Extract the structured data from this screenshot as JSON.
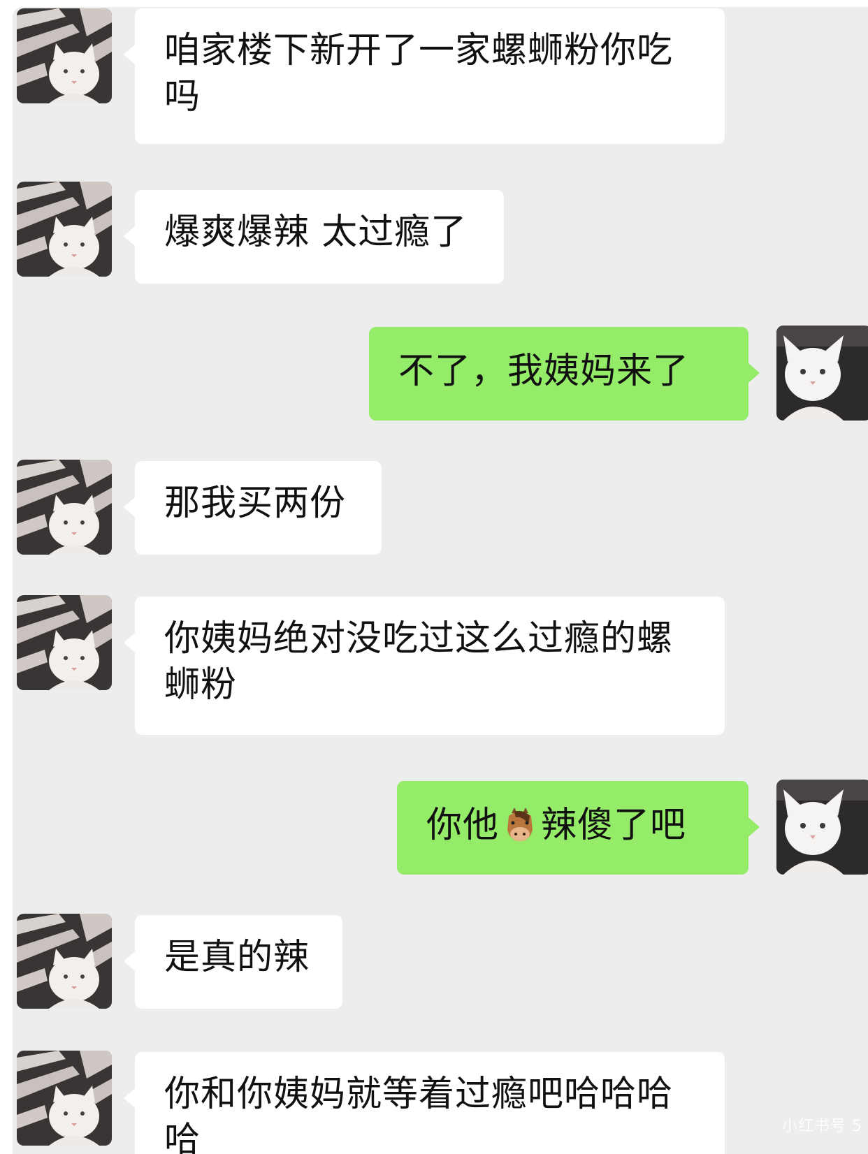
{
  "colors": {
    "chat_background": "#ededed",
    "incoming_bubble": "#ffffff",
    "outgoing_bubble": "#95ec69",
    "text": "#111111"
  },
  "messages": [
    {
      "side": "incoming",
      "text": "咱家楼下新开了一家螺蛳粉你吃吗"
    },
    {
      "side": "incoming",
      "text": "爆爽爆辣 太过瘾了"
    },
    {
      "side": "outgoing",
      "text": "不了，我姨妈来了"
    },
    {
      "side": "incoming",
      "text": "那我买两份"
    },
    {
      "side": "incoming",
      "text": "你姨妈绝对没吃过这么过瘾的螺蛳粉"
    },
    {
      "side": "outgoing",
      "text_before": "你他",
      "emoji": "horse-face",
      "text_after": "辣傻了吧"
    },
    {
      "side": "incoming",
      "text": "是真的辣"
    },
    {
      "side": "incoming",
      "text": "你和你姨妈就等着过瘾吧哈哈哈哈"
    }
  ],
  "avatars": {
    "contact": "striped-background-white-cat",
    "self": "white-cat-dark-background"
  },
  "watermark": "小红书号 5"
}
